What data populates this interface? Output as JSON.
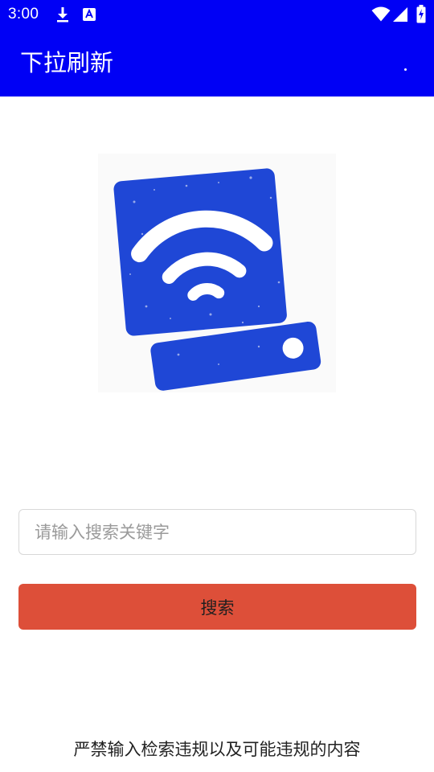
{
  "status_bar": {
    "time": "3:00",
    "icons": [
      "download-icon",
      "a11y-notification-icon",
      "wifi-icon",
      "signal-icon",
      "battery-icon"
    ]
  },
  "app_bar": {
    "title": "下拉刷新",
    "menu_icon": "overflow-menu-icon"
  },
  "logo": {
    "icon": "wifi-drive-logo-icon"
  },
  "search": {
    "placeholder": "请输入搜索关键字",
    "value": "",
    "button_label": "搜索"
  },
  "footer": {
    "notice": "严禁输入检索违规以及可能违规的内容"
  },
  "colors": {
    "app_bar": "#0000f5",
    "button": "#dd4f39",
    "logo_blue": "#1f47d6"
  }
}
